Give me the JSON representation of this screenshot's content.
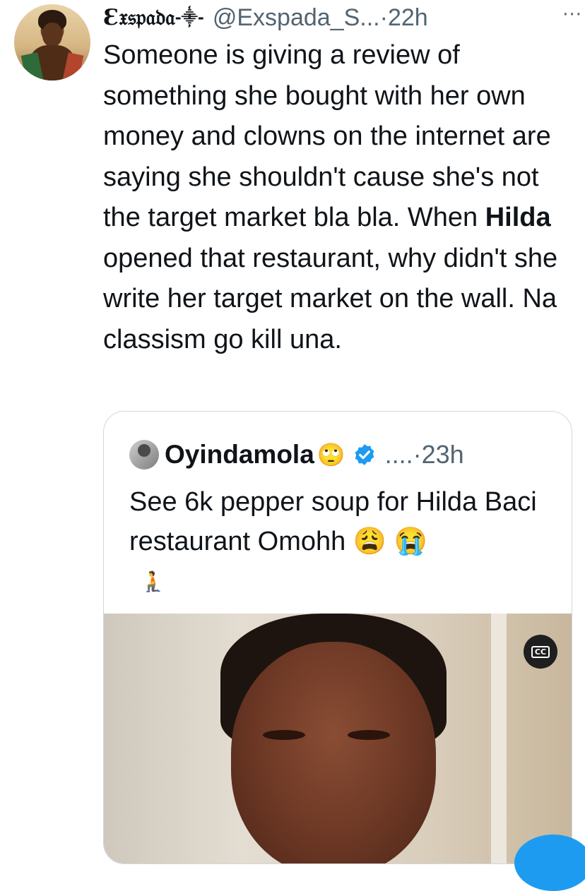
{
  "tweet": {
    "author_name": "Ɛ𝔵𝔰𝔭𝔞𝔡𝔞",
    "author_name_symbol": "-⸎-",
    "author_handle": "@Exspada_S...",
    "separator": "·",
    "time": "22h",
    "more_label": "···",
    "text_before_bold": "Someone is giving a review of something she bought with her own money and clowns on the internet are saying she shouldn't cause she's not the target market bla bla. When ",
    "text_bold": "Hilda",
    "text_after_bold": " opened that restaurant, why didn't she write her target market on the wall. Na classism go kill una."
  },
  "quoted_tweet": {
    "author_name": "Oyindamola",
    "name_emoji": "🙄",
    "verified": true,
    "truncation": "....",
    "separator": "·",
    "time": "23h",
    "text": "See 6k pepper soup for Hilda Baci restaurant Omohh 😩 😭",
    "extra_emoji": "🧎",
    "media": {
      "type": "video",
      "cc_label": "CC"
    }
  },
  "colors": {
    "text_primary": "#0f1419",
    "text_secondary": "#536471",
    "border": "#cfd9de",
    "accent_blue": "#1d9bf0"
  }
}
